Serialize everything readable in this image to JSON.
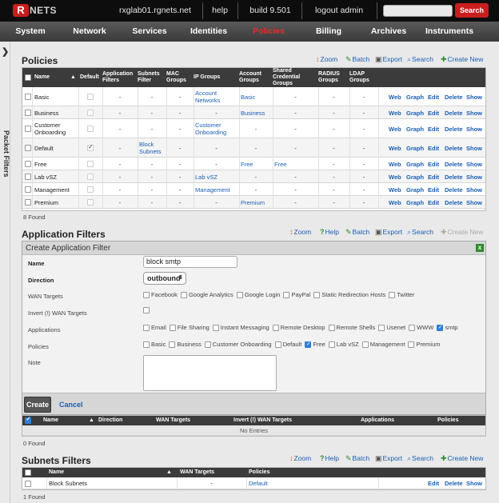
{
  "brand": {
    "logo_letter": "R",
    "logo_text": "NETS"
  },
  "topbar": {
    "hostname": "rxglab01.rgnets.net",
    "help": "help",
    "build": "build 9.501",
    "logout": "logout admin",
    "search_value": "",
    "search_button": "Search"
  },
  "nav": [
    "System",
    "Network",
    "Services",
    "Identities",
    "Policies",
    "Billing",
    "Archives",
    "Instruments"
  ],
  "nav_active": "Policies",
  "sidebar": {
    "label": "Packet Filters"
  },
  "tools": {
    "zoom": "Zoom",
    "help": "Help",
    "batch": "Batch",
    "export": "Export",
    "search": "Search",
    "create_new": "Create New"
  },
  "policies": {
    "title": "Policies",
    "headers": [
      "Name",
      "Default",
      "Application Filters",
      "Subnets Filter",
      "MAC Groups",
      "IP Groups",
      "Account Groups",
      "Shared Credential Groups",
      "RADIUS Groups",
      "LDAP Groups"
    ],
    "rows": [
      {
        "name": "Basic",
        "default": false,
        "app": "-",
        "subnets": "-",
        "mac": "-",
        "ip": "Account Networks",
        "account": "Basic",
        "shared": "-",
        "radius": "-",
        "ldap": "-"
      },
      {
        "name": "Business",
        "default": false,
        "app": "-",
        "subnets": "-",
        "mac": "-",
        "ip": "-",
        "account": "Business",
        "shared": "-",
        "radius": "-",
        "ldap": "-"
      },
      {
        "name": "Customer Onboarding",
        "default": false,
        "app": "-",
        "subnets": "-",
        "mac": "-",
        "ip": "Customer Onboarding",
        "account": "-",
        "shared": "-",
        "radius": "-",
        "ldap": "-"
      },
      {
        "name": "Default",
        "default": true,
        "app": "-",
        "subnets": "Block Subnets",
        "mac": "-",
        "ip": "-",
        "account": "-",
        "shared": "-",
        "radius": "-",
        "ldap": "-"
      },
      {
        "name": "Free",
        "default": false,
        "app": "-",
        "subnets": "-",
        "mac": "-",
        "ip": "-",
        "account": "Free",
        "shared": "Free",
        "radius": "-",
        "ldap": "-"
      },
      {
        "name": "Lab vSZ",
        "default": false,
        "app": "-",
        "subnets": "-",
        "mac": "-",
        "ip": "Lab vSZ",
        "account": "-",
        "shared": "-",
        "radius": "-",
        "ldap": "-"
      },
      {
        "name": "Management",
        "default": false,
        "app": "-",
        "subnets": "-",
        "mac": "-",
        "ip": "Management",
        "account": "-",
        "shared": "-",
        "radius": "-",
        "ldap": "-"
      },
      {
        "name": "Premium",
        "default": false,
        "app": "-",
        "subnets": "-",
        "mac": "-",
        "ip": "-",
        "account": "Premium",
        "shared": "-",
        "radius": "-",
        "ldap": "-"
      }
    ],
    "actions": [
      "Web",
      "Graph",
      "Edit",
      "Delete",
      "Show"
    ],
    "count": "8 Found"
  },
  "app_filters": {
    "title": "Application Filters",
    "form": {
      "header": "Create Application Filter",
      "close": "x",
      "name_label": "Name",
      "name_value": "block smtp",
      "direction_label": "Direction",
      "direction_value": "outbound",
      "wan_label": "WAN Targets",
      "wan_options": [
        {
          "label": "Facebook",
          "checked": false
        },
        {
          "label": "Google Analytics",
          "checked": false
        },
        {
          "label": "Google Login",
          "checked": false
        },
        {
          "label": "PayPal",
          "checked": false
        },
        {
          "label": "Static Redirection Hosts",
          "checked": false
        },
        {
          "label": "Twitter",
          "checked": false
        }
      ],
      "invert_label": "Invert (!) WAN Targets",
      "apps_label": "Applications",
      "apps_options": [
        {
          "label": "Email",
          "checked": false
        },
        {
          "label": "File Sharing",
          "checked": false
        },
        {
          "label": "Instant Messaging",
          "checked": false
        },
        {
          "label": "Remote Desktop",
          "checked": false
        },
        {
          "label": "Remote Shells",
          "checked": false
        },
        {
          "label": "Usenet",
          "checked": false
        },
        {
          "label": "WWW",
          "checked": false
        },
        {
          "label": "smtp",
          "checked": true
        }
      ],
      "policies_label": "Policies",
      "policies_options": [
        {
          "label": "Basic",
          "checked": false
        },
        {
          "label": "Business",
          "checked": false
        },
        {
          "label": "Customer Onboarding",
          "checked": false
        },
        {
          "label": "Default",
          "checked": false
        },
        {
          "label": "Free",
          "checked": true
        },
        {
          "label": "Lab vSZ",
          "checked": false
        },
        {
          "label": "Management",
          "checked": false
        },
        {
          "label": "Premium",
          "checked": false
        }
      ],
      "note_label": "Note",
      "create_button": "Create",
      "cancel_link": "Cancel"
    },
    "headers": [
      "Name",
      "Direction",
      "WAN Targets",
      "Invert (!) WAN Targets",
      "Applications",
      "Policies"
    ],
    "empty": "No Entries",
    "count": "0 Found"
  },
  "subnets_filters": {
    "title": "Subnets Filters",
    "headers": [
      "Name",
      "WAN Targets",
      "Policies"
    ],
    "rows": [
      {
        "name": "Block Subnets",
        "wan": "-",
        "policies": "Default"
      }
    ],
    "actions": [
      "Edit",
      "Delete",
      "Show"
    ],
    "count": "1 Found"
  }
}
